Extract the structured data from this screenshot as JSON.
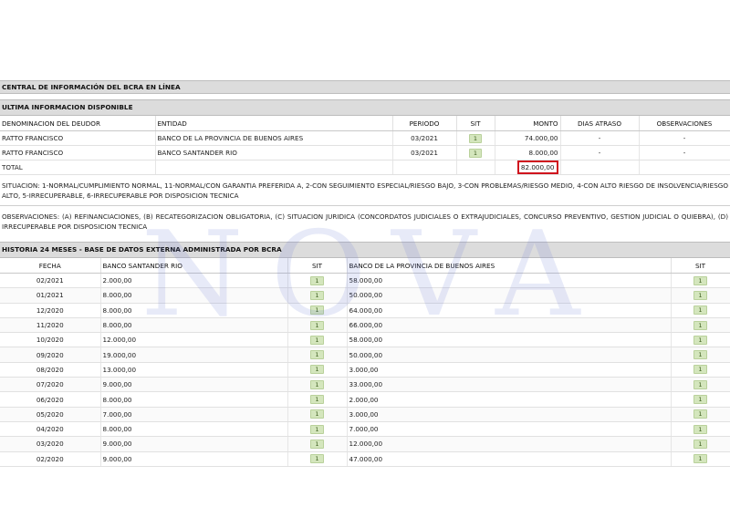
{
  "title": "CENTRAL DE INFORMACIÓN DEL BCRA EN LÍNEA",
  "last_info": {
    "header": "ULTIMA INFORMACION DISPONIBLE",
    "columns": [
      "DENOMINACION DEL DEUDOR",
      "ENTIDAD",
      "PERIODO",
      "SIT",
      "MONTO",
      "DIAS ATRASO",
      "OBSERVACIONES"
    ],
    "rows": [
      {
        "deudor": "RATTO FRANCISCO",
        "entidad": "BANCO DE LA PROVINCIA DE BUENOS AIRES",
        "periodo": "03/2021",
        "sit": "1",
        "monto": "74.000,00",
        "dias": "-",
        "obs": "-"
      },
      {
        "deudor": "RATTO FRANCISCO",
        "entidad": "BANCO SANTANDER RIO",
        "periodo": "03/2021",
        "sit": "1",
        "monto": "8.000,00",
        "dias": "-",
        "obs": "-"
      }
    ],
    "total_label": "TOTAL",
    "total_value": "82.000,00"
  },
  "situacion_note": "SITUACION: 1-NORMAL/CUMPLIMIENTO NORMAL, 11-NORMAL/CON GARANTIA PREFERIDA A, 2-CON SEGUIMIENTO ESPECIAL/RIESGO BAJO, 3-CON PROBLEMAS/RIESGO MEDIO, 4-CON ALTO RIESGO DE INSOLVENCIA/RIESGO ALTO, 5-IRRECUPERABLE, 6-IRRECUPERABLE POR DISPOSICION TECNICA",
  "observaciones_note": "OBSERVACIONES: (A) REFINANCIACIONES, (B) RECATEGORIZACION OBLIGATORIA, (C) SITUACION JURIDICA (CONCORDATOS JUDICIALES O EXTRAJUDICIALES, CONCURSO PREVENTIVO, GESTION JUDICIAL O QUIEBRA), (D) IRRECUPERABLE POR DISPOSICION TECNICA",
  "history": {
    "header": "HISTORIA 24 MESES - BASE DE DATOS EXTERNA ADMINISTRADA POR BCRA",
    "columns": [
      "FECHA",
      "BANCO SANTANDER RIO",
      "SIT",
      "BANCO DE LA PROVINCIA DE BUENOS AIRES",
      "SIT"
    ],
    "rows": [
      {
        "fecha": "02/2021",
        "santander": "2.000,00",
        "sit1": "1",
        "provincia": "58.000,00",
        "sit2": "1"
      },
      {
        "fecha": "01/2021",
        "santander": "8.000,00",
        "sit1": "1",
        "provincia": "50.000,00",
        "sit2": "1"
      },
      {
        "fecha": "12/2020",
        "santander": "8.000,00",
        "sit1": "1",
        "provincia": "64.000,00",
        "sit2": "1"
      },
      {
        "fecha": "11/2020",
        "santander": "8.000,00",
        "sit1": "1",
        "provincia": "66.000,00",
        "sit2": "1"
      },
      {
        "fecha": "10/2020",
        "santander": "12.000,00",
        "sit1": "1",
        "provincia": "58.000,00",
        "sit2": "1"
      },
      {
        "fecha": "09/2020",
        "santander": "19.000,00",
        "sit1": "1",
        "provincia": "50.000,00",
        "sit2": "1"
      },
      {
        "fecha": "08/2020",
        "santander": "13.000,00",
        "sit1": "1",
        "provincia": "3.000,00",
        "sit2": "1"
      },
      {
        "fecha": "07/2020",
        "santander": "9.000,00",
        "sit1": "1",
        "provincia": "33.000,00",
        "sit2": "1"
      },
      {
        "fecha": "06/2020",
        "santander": "8.000,00",
        "sit1": "1",
        "provincia": "2.000,00",
        "sit2": "1"
      },
      {
        "fecha": "05/2020",
        "santander": "7.000,00",
        "sit1": "1",
        "provincia": "3.000,00",
        "sit2": "1"
      },
      {
        "fecha": "04/2020",
        "santander": "8.000,00",
        "sit1": "1",
        "provincia": "7.000,00",
        "sit2": "1"
      },
      {
        "fecha": "03/2020",
        "santander": "9.000,00",
        "sit1": "1",
        "provincia": "12.000,00",
        "sit2": "1"
      },
      {
        "fecha": "02/2020",
        "santander": "9.000,00",
        "sit1": "1",
        "provincia": "47.000,00",
        "sit2": "1"
      }
    ]
  },
  "watermark": "NOVA",
  "colors": {
    "header_bg": "#dcdcdc",
    "sit_badge": "#d4e6bd",
    "highlight_border": "#d0141e",
    "watermark": "#6f7fd6"
  }
}
